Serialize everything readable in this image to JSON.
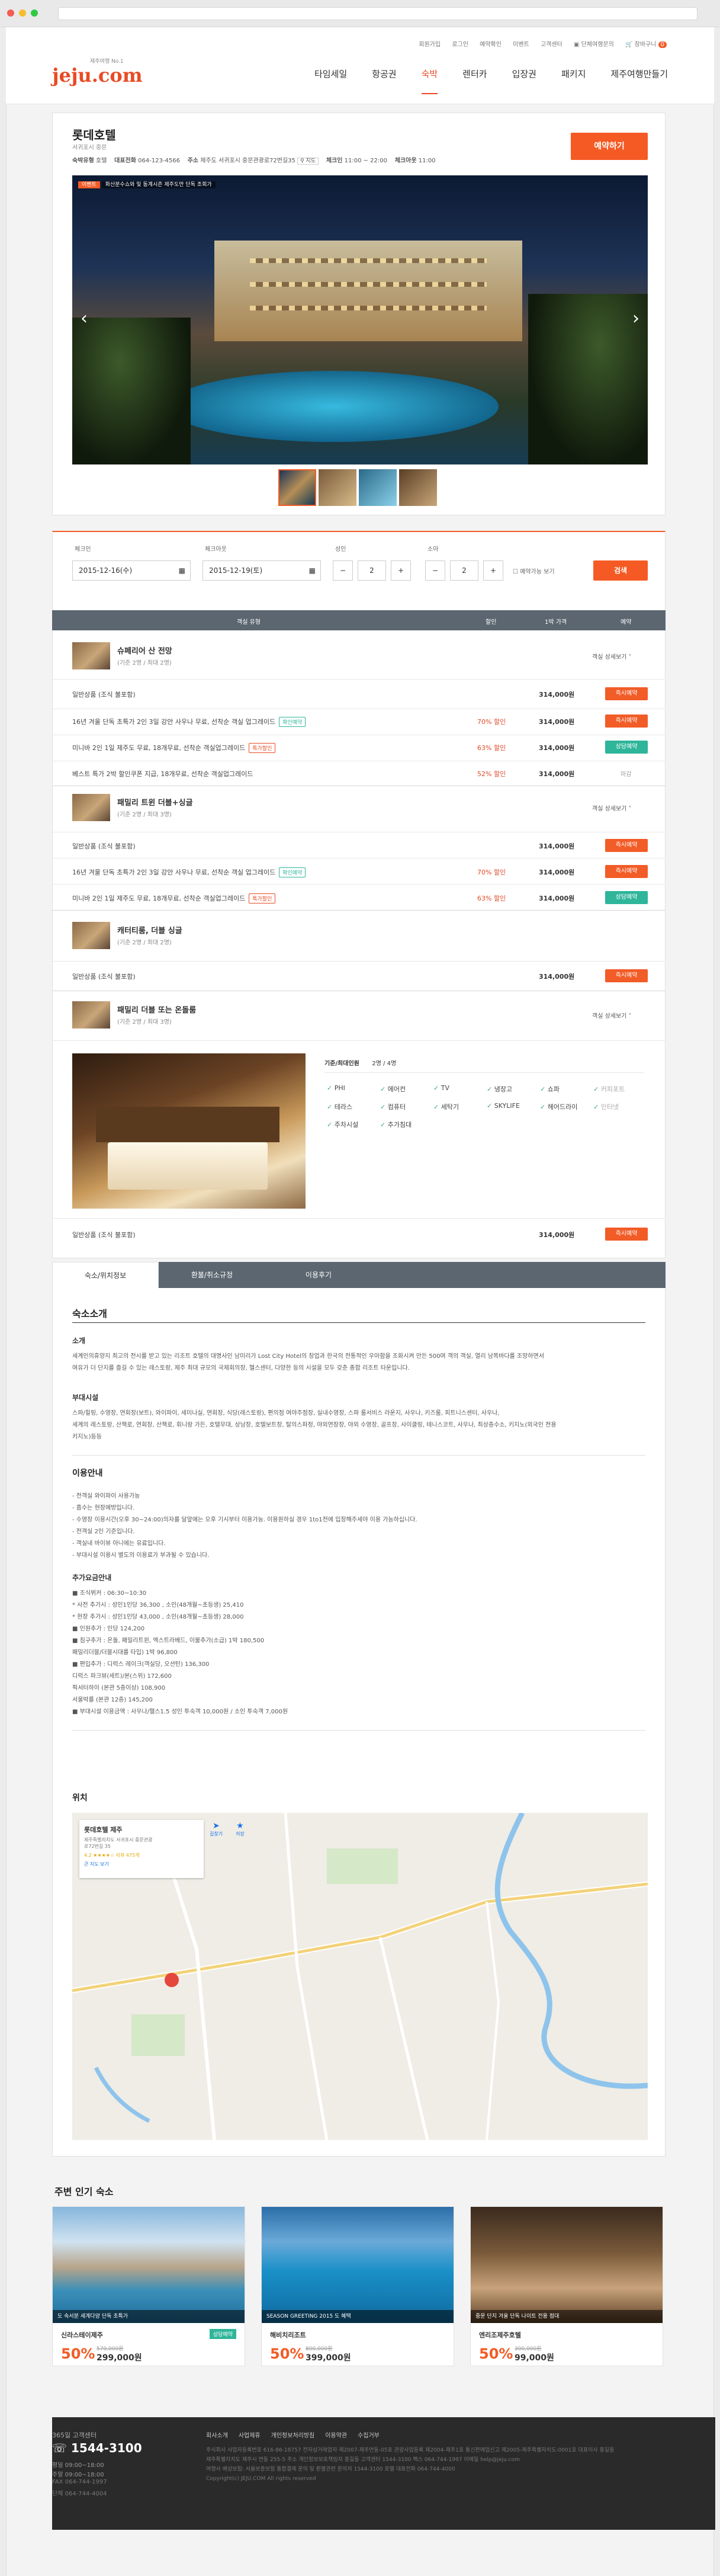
{
  "util_links": [
    "회원가입",
    "로그인",
    "예약확인",
    "이벤트",
    "고객센터",
    "단체여행문의",
    "장바구니"
  ],
  "cart_count": "0",
  "logo": {
    "text": "jeju.com",
    "tagline": "제주여행 No.1"
  },
  "gnb": [
    "타임세일",
    "항공권",
    "숙박",
    "렌터카",
    "입장권",
    "패키지",
    "제주여행만들기"
  ],
  "hotel": {
    "name": "롯데호텔",
    "location": "서귀포시 중문",
    "grade_label": "숙박유형",
    "grade": "호텔",
    "phone_label": "대표전화",
    "phone": "064-123-4566",
    "addr_label": "주소",
    "addr": "제주도 서귀포시 중문관광로72번길35",
    "map_btn": "지도",
    "checkin_label": "체크인",
    "checkin": "11:00 ~ 22:00",
    "checkout_label": "체크아웃",
    "checkout": "11:00",
    "book_btn": "예약하기",
    "photo_badge": "이벤트",
    "photo_caption": "화산분수쇼와 및 동계시즌 제주도만 단독 조회가"
  },
  "search": {
    "checkin_label": "체크인",
    "checkin_value": "2015-12-16(수)",
    "checkout_label": "체크아웃",
    "checkout_value": "2015-12-19(토)",
    "adult_label": "성인",
    "adult_value": "2",
    "child_label": "소아",
    "child_value": "2",
    "avail_label": "예약가능 보기",
    "search_btn": "검색"
  },
  "table_head": [
    "객실 유형",
    "할인",
    "1박 가격",
    "예약"
  ],
  "rooms": [
    {
      "name": "슈페리어 산 전망",
      "spec": "(기준 2명 / 최대 2명)",
      "more": "객실 상세보기 ˅",
      "rates": [
        {
          "title": "일반상품 (조식 불포함)",
          "tag": "",
          "tag_type": "",
          "disc": "",
          "price": "314,000원",
          "btn": "즉시예약",
          "btn_type": "orange"
        },
        {
          "title": "16년 겨울 단독 초특가 2인 3일 강안 사우나 무료, 선착순 객실 업그레이드",
          "tag": "확인예약",
          "tag_type": "t",
          "disc": "70% 할인",
          "price": "314,000원",
          "btn": "즉시예약",
          "btn_type": "orange"
        },
        {
          "title": "미니바 2인 1일 제주도 무료, 18개무료, 선착순 객실업그레이드",
          "tag": "특가할인",
          "tag_type": "r",
          "disc": "63% 할인",
          "price": "314,000원",
          "btn": "상담예약",
          "btn_type": "teal"
        },
        {
          "title": "베스트 특가 2박 할인쿠폰 지급, 18개무료, 선착순 객실업그레이드",
          "tag": "",
          "tag_type": "",
          "disc": "52% 할인",
          "price": "314,000원",
          "btn": "마감",
          "btn_type": "none"
        }
      ]
    },
    {
      "name": "패밀리 트윈 더블+싱글",
      "spec": "(기준 2명 / 최대 3명)",
      "more": "객실 상세보기 ˅",
      "rates": [
        {
          "title": "일반상품 (조식 불포함)",
          "tag": "",
          "tag_type": "",
          "disc": "",
          "price": "314,000원",
          "btn": "즉시예약",
          "btn_type": "orange"
        },
        {
          "title": "16년 겨울 단독 초특가 2인 3일 강안 사우나 무료, 선착순 객실 업그레이드",
          "tag": "확인예약",
          "tag_type": "t",
          "disc": "70% 할인",
          "price": "314,000원",
          "btn": "즉시예약",
          "btn_type": "orange"
        },
        {
          "title": "미니바 2인 1일 제주도 무료, 18개무료, 선착순 객실업그레이드",
          "tag": "특가할인",
          "tag_type": "r",
          "disc": "63% 할인",
          "price": "314,000원",
          "btn": "상담예약",
          "btn_type": "teal"
        }
      ]
    },
    {
      "name": "캐터티룸, 더블 싱글",
      "spec": "(기준 2명 / 최대 2명)",
      "more": "",
      "rates": [
        {
          "title": "일반상품 (조식 불포함)",
          "tag": "",
          "tag_type": "",
          "disc": "",
          "price": "314,000원",
          "btn": "즉시예약",
          "btn_type": "orange"
        }
      ]
    },
    {
      "name": "패밀리 더블 또는 온돌룸",
      "spec": "(기준 2명 / 최대 3명)",
      "more": "객실 상세보기 ˄",
      "rates": [
        {
          "title": "일반상품 (조식 불포함)",
          "tag": "",
          "tag_type": "",
          "disc": "",
          "price": "314,000원",
          "btn": "즉시예약",
          "btn_type": "orange"
        }
      ]
    }
  ],
  "detail": {
    "occupancy_label": "기준/최대인원",
    "occupancy": "2명 / 4명",
    "amenities": [
      "PHI",
      "에어컨",
      "TV",
      "냉장고",
      "쇼파",
      "커피포트",
      "테라스",
      "컴퓨터",
      "세탁기",
      "SKYLIFE",
      "헤어드라이",
      "인터넷",
      "주차시설",
      "추가침대"
    ]
  },
  "tabs": [
    "숙소/위치정보",
    "환불/취소규정",
    "이용후기"
  ],
  "info": {
    "h_intro": "숙소소개",
    "sub1": "소개",
    "intro_lines": [
      "세계인의휴양지 최고의 전시를 받고 있는 리조트 호텔의 대명사인 남미리가 Lost City Hotel의 창업과 한국의 전통적인 우아함을 조화시켜 만든 500여 객의 객실, 열리 남쪽바다를 조망하면서",
      "여유가 더 단지를 즐길 수 있는 레스토랑, 제주 최대 규모의 국제회의장, 헬스센터, 다양한 등의 시설을 모두 갖춘 종합 리조트 타운입니다."
    ],
    "sub2": "부대시설",
    "facility_lines": [
      "스파/힐링, 수영장, 연회장(보트), 와이파이, 세미나실, 연회장, 식당(레스토랑), 편의점 여야주점장, 실내수영장, 스파 룸서비스 라운지, 사우나, 키즈룸, 피트니스센터, 사우나,",
      "세계의 레스토랑, 산책로, 연회장, 산책로, 휘니랑 가든, 호텔무대, 상남장, 호텔보트장, 탈의스파정, 야외연장장, 야외 수영장, 골프장, 사이클링, 테니스코트, 사우나, 최상층수소, 키지노(외국인 전용",
      "키지노)등등"
    ],
    "h_guide": "이용안내",
    "guide_lines": [
      "- 전객실 와이파이 사용가능",
      "- 흡수는 현장에방입니다.",
      "- 수영장 이용시간(오후 30~24:00)의자를 달앞에는 오후 기시부터 이용가능. 이용원하실 경우 1to1전에 입장해주세야 이용 가능하십니다.",
      "- 전객실 2인 기준입니다.",
      "- 객실내 바이뷰 아니에는 유료입니다.",
      "- 부대시설 이용시 별도의 이용료가 부과될 수 있습니다."
    ],
    "h_extra": "추가요금안내",
    "extra_lines": [
      "■ 조식뷔커 : 06:30~10:30",
      "* 사전 추가시 : 성인1인당 36,300 , 소인(48개월~초등생) 25,410",
      "* 현장 추가시 : 성인1인당 43,000 , 소인(48개월~초등생) 28,000",
      "■ 인원추가 : 인당 124,200",
      "■ 침구추가 : 온돌, 패밀리트윈, 엑스트라베드, 이불추가(소급) 1박 180,500",
      "패밀리더블/더블시대를 타입) 1박 96,800",
      "■ 편입추가 : 디럭스 레이크(객실당, 오션턴) 136,300",
      "디럭스 파크뷰(세트)/본(스위) 172,600",
      "픽서터하이 (본관 5층이상) 108,900",
      "서울박를 (본관 12층) 145,200",
      "■ 부대시설 이용금액 : 사우나/헬스1.5 성인 투숙객 10,000원 / 소인 투숙객 7,000원"
    ],
    "h_map": "위치",
    "map_hotel": "롯데호텔 제주",
    "map_addr1": "제주특별자치도 서귀포시 중문관광",
    "map_addr2": "로72번길 35",
    "map_rating": "4.2 ★★★★☆ 리뷰 475개",
    "map_more": "큰 지도 보기",
    "map_route": "길찾기",
    "map_save": "저장"
  },
  "nearby": {
    "title": "주변 인기 숙소",
    "items": [
      {
        "caption": "도 속서분 세계다양 단독 초특가",
        "name": "신라스테이제주",
        "badge": "상담예약",
        "orig": "570,000원",
        "pct": "50%",
        "price": "299,000원"
      },
      {
        "caption": "SEASON GREETING 2015 도 혜택",
        "name": "해비치리조트",
        "badge": "",
        "orig": "800,000원",
        "pct": "50%",
        "price": "399,000원"
      },
      {
        "caption": "중문 단지 겨울 단독 나이트 전용 점대",
        "name": "엔리조제주호텔",
        "badge": "",
        "orig": "300,000원",
        "pct": "50%",
        "price": "99,000원"
      }
    ]
  },
  "footer": {
    "cs_label": "365일 고객센터",
    "cs_phone": "1544-3100",
    "weekday": "평일 09:00~18:00",
    "weekend": "주말 09:00~18:00",
    "fax_label": "FAX",
    "fax": "064-744-1997",
    "tel_label": "단체",
    "tel": "064-744-4004",
    "links": [
      "회사소개",
      "사업제휴",
      "개인정보처리방침",
      "이용약관",
      "수집거부"
    ],
    "lines": [
      "주식회사 사업자등록번호 616-86-18757 전자상거래업자 제2007-제주연동-05호 관광사업등록 제2004-제주1호 통신판매업신고 제2005-제주특별자치도-0001호 대표이사 홍길동",
      "제주특별자치도 제주시 연동 255-5 주소 개인정보보호책임자 홍길동 고객센터 1544-3100 팩스 064-744-1997 이메일 help@jeju.com",
      "여행사 배상보험: 서울보증보험 통합결제 문의 및 환불관련 문의처 1544-3100 호텔 대표전화 064-744-4000",
      "Copyright(c) JEJU.COM All rights reserved"
    ]
  }
}
